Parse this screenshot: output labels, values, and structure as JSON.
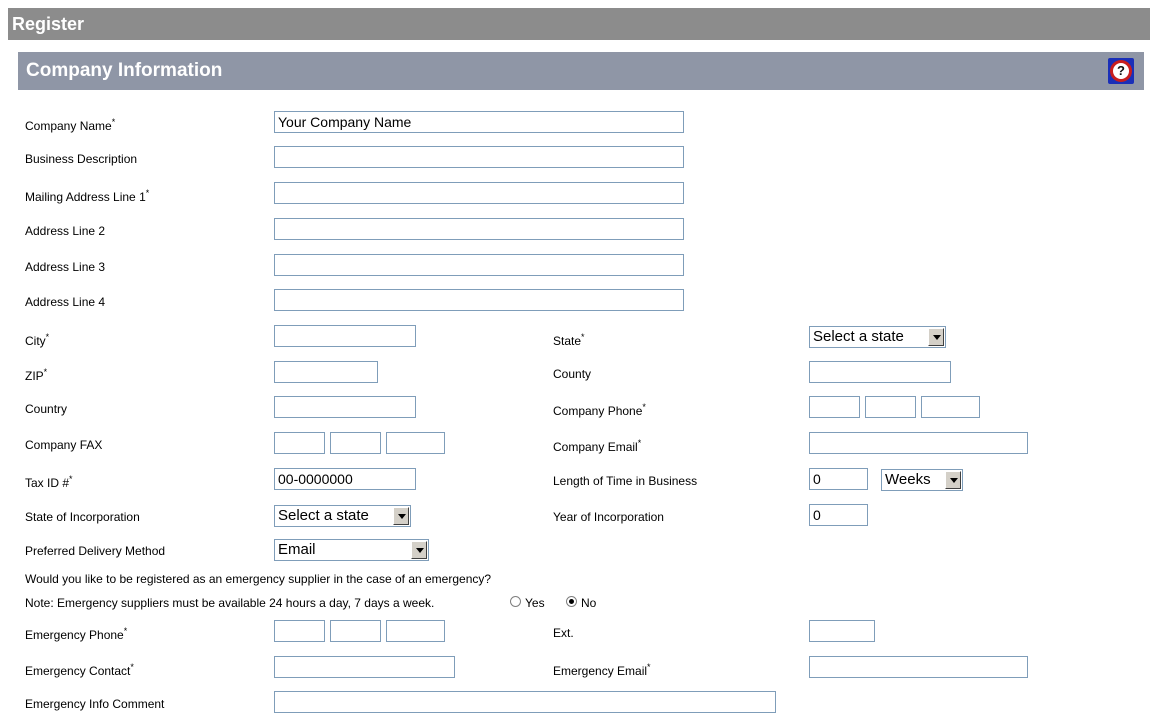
{
  "header": {
    "title": "Register"
  },
  "section": {
    "title": "Company Information",
    "help_glyph": "?"
  },
  "labels": {
    "company_name": "Company Name",
    "business_description": "Business Description",
    "mailing_address_1": "Mailing Address Line 1",
    "address_2": "Address Line 2",
    "address_3": "Address Line 3",
    "address_4": "Address Line 4",
    "city": "City",
    "state": "State",
    "zip": "ZIP",
    "county": "County",
    "country": "Country",
    "company_phone": "Company Phone",
    "company_fax": "Company FAX",
    "company_email": "Company Email",
    "tax_id": "Tax ID #",
    "length_in_business": "Length of Time in Business",
    "state_of_incorporation": "State of Incorporation",
    "year_of_incorporation": "Year of Incorporation",
    "preferred_delivery": "Preferred Delivery Method",
    "emergency_question": "Would you like to be registered as an emergency supplier in the case of an emergency?",
    "emergency_note": "Note: Emergency suppliers must be available 24 hours a day, 7 days a week.",
    "yes": "Yes",
    "no": "No",
    "emergency_phone": "Emergency Phone",
    "ext": "Ext.",
    "emergency_contact": "Emergency Contact",
    "emergency_email": "Emergency Email",
    "emergency_comment": "Emergency Info Comment"
  },
  "required_marker": "*",
  "values": {
    "company_name": "Your Company Name",
    "tax_id": "00-0000000",
    "length_in_business": "0",
    "length_unit": "Weeks",
    "state": "Select a state",
    "state_of_incorporation": "Select a state",
    "year_of_incorporation": "0",
    "preferred_delivery": "Email",
    "emergency_supplier_selected": "No"
  }
}
